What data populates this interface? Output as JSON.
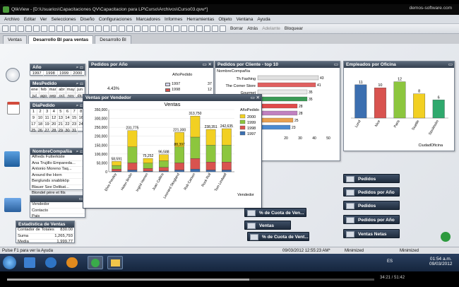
{
  "window": {
    "title": "QlikView - [D:\\Usuarios\\Capacitaciones QV\\Capacitacion para LP\\Curso\\Archivos\\Curso03.qvw*]",
    "brand": "demos-software.com"
  },
  "menu": [
    "Archivo",
    "Editar",
    "Ver",
    "Selecciones",
    "Diseño",
    "Configuraciones",
    "Marcadores",
    "Informes",
    "Herramientas",
    "Objeto",
    "Ventana",
    "Ayuda"
  ],
  "toolbar": {
    "clear": "Borrar",
    "back": "Atrás",
    "forward": "Adelante",
    "lock": "Bloquear"
  },
  "tabs": [
    {
      "label": "Ventas"
    },
    {
      "label": "Desarrollo BI para ventas"
    },
    {
      "label": "Desarrollo BI"
    }
  ],
  "year_box": {
    "title": "Año",
    "values": [
      "1997",
      "1998",
      "1999",
      "2000"
    ]
  },
  "month_box": {
    "title": "MesPedido",
    "values": [
      "ene",
      "feb",
      "mar",
      "abr",
      "may",
      "jun",
      "jul",
      "ago",
      "sep",
      "oct",
      "nov",
      "dic"
    ]
  },
  "day_box": {
    "title": "DiaPedido",
    "values": [
      "1",
      "2",
      "3",
      "4",
      "5",
      "6",
      "7",
      "8",
      "9",
      "10",
      "11",
      "12",
      "13",
      "14",
      "15",
      "16",
      "17",
      "18",
      "19",
      "20",
      "21",
      "22",
      "23",
      "24",
      "25",
      "26",
      "27",
      "28",
      "29",
      "30",
      "31"
    ]
  },
  "company_box": {
    "title": "NombreCompañia",
    "items": [
      "Alfreds Futterkiste",
      "Ana Trujillo Empareda...",
      "Antonio Moreno Taq...",
      "Around the Horn",
      "Berglunds snabbköp",
      "Blauer See Delikat...",
      "Blondel père et fils",
      "Bólido Comidas prep..."
    ]
  },
  "contact_box": {
    "rows": [
      {
        "label": "Vendedor"
      },
      {
        "label": "Contacto"
      },
      {
        "label": "Pais"
      }
    ]
  },
  "stats_box": {
    "title": "Estadística de Ventas",
    "rows": [
      {
        "label": "Contador de Totales",
        "value": "830.00"
      },
      {
        "label": "Suma",
        "value": "1,265,793"
      },
      {
        "label": "Media",
        "value": "1,999.77"
      }
    ]
  },
  "pedidos_anio": {
    "title": "Pedidos por Año",
    "pct": "4.43%",
    "legend_title": "AñoPedido",
    "rows": [
      {
        "year": "1997",
        "value": "37"
      },
      {
        "year": "1998",
        "value": "12"
      }
    ]
  },
  "pedidos_cliente": {
    "title": "Pedidos por Cliente - top 10",
    "header": "NombreCompañia",
    "bars": [
      {
        "name": "Th Fashing",
        "value": 43,
        "color": "#e0e0e0",
        "label": "43"
      },
      {
        "name": "The Corner Store",
        "value": 41,
        "color": "#e06060",
        "label": "41"
      },
      {
        "name": "Gourmet",
        "value": 35,
        "color": "#e8e8e8",
        "label": "35"
      },
      {
        "name": "",
        "value": 35,
        "color": "#3a9a55",
        "label": "35"
      },
      {
        "name": "",
        "value": 28,
        "color": "#e04a4a",
        "label": "28"
      },
      {
        "name": "",
        "value": 28,
        "color": "#c080c0",
        "label": "28"
      },
      {
        "name": "",
        "value": 25,
        "color": "#e8a050",
        "label": "25"
      },
      {
        "name": "",
        "value": 23,
        "color": "#4a8ad0",
        "label": "23"
      }
    ],
    "ticks": [
      "20",
      "30",
      "40",
      "50"
    ]
  },
  "empleados": {
    "title": "Empleados por Oficina",
    "xlabel": "CiudadOficina",
    "ylim": [
      0,
      14
    ],
    "bars": [
      {
        "city": "Lond",
        "value": 11,
        "color": "#3c6fb0"
      },
      {
        "city": "Nice",
        "value": 10,
        "color": "#d9534f"
      },
      {
        "city": "Paris",
        "value": 12,
        "color": "#8cc63e"
      },
      {
        "city": "Seattle",
        "value": 8,
        "color": "#f2d022"
      },
      {
        "city": "Stockholm",
        "value": 6,
        "color": "#2fa96d"
      }
    ]
  },
  "ventas_vendedor": {
    "window_title": "Ventas por Vendedor",
    "title": "Ventas",
    "legend_title": "AñoPedido",
    "xlabel": "Vendedor"
  },
  "chart_data": {
    "type": "bar",
    "title": "Ventas",
    "xlabel": "Vendedor",
    "ylabel": "",
    "ylim": [
      0,
      350000
    ],
    "yticks": [
      "0",
      "50,000",
      "100,000",
      "150,000",
      "200,000",
      "250,000",
      "300,000",
      "350,000"
    ],
    "categories": [
      "Elvis Presley",
      "Helen Brolin",
      "Ingrid Herren",
      "Joan Callins",
      "Leonard Skogland",
      "Rob Carson",
      "Rock Roll",
      "Tom Lindwall"
    ],
    "totals": [
      58591,
      231775,
      75252,
      96588,
      221300,
      313750,
      238351,
      242635
    ],
    "total_labels": [
      "58,591",
      "231,775",
      "75,252",
      "96,588",
      "221,300",
      "313,750",
      "238,351",
      "242,635"
    ],
    "extra_labels": [
      {
        "index": 4,
        "label": "88,397"
      }
    ],
    "series": [
      {
        "name": "1997",
        "color": "#3c6fb0",
        "values": [
          3000,
          10000,
          4000,
          5000,
          10000,
          15000,
          10000,
          10000
        ]
      },
      {
        "name": "1998",
        "color": "#d9534f",
        "values": [
          12000,
          40000,
          15000,
          20000,
          40000,
          60000,
          45000,
          45000
        ]
      },
      {
        "name": "1999",
        "color": "#8cc63e",
        "values": [
          20591,
          90000,
          30000,
          36588,
          90000,
          120000,
          95000,
          95000
        ]
      },
      {
        "name": "2000",
        "color": "#f2d022",
        "values": [
          23000,
          91775,
          26252,
          35000,
          81300,
          118750,
          88351,
          92635
        ]
      }
    ]
  },
  "buttons": [
    {
      "label": "% de Cuota de Ven..."
    },
    {
      "label": "Ventas"
    },
    {
      "label": "% de Cuota de Vent..."
    },
    {
      "label": "Pedidos"
    },
    {
      "label": "Pedidos por Año"
    },
    {
      "label": "Pedidos"
    },
    {
      "label": "Pedidos por Año"
    },
    {
      "label": "Ventas Netas"
    }
  ],
  "status": {
    "help": "Pulse F1 para ver la Ayuda",
    "date": "09/03/2012 12:55:23 AM*",
    "min1": "Minimized",
    "min2": "Minimized"
  },
  "taskbar": {
    "time": "01:54 a.m.",
    "date": "09/03/2012",
    "lang": "ES"
  },
  "player": {
    "time": "34:21 / 51:42"
  }
}
